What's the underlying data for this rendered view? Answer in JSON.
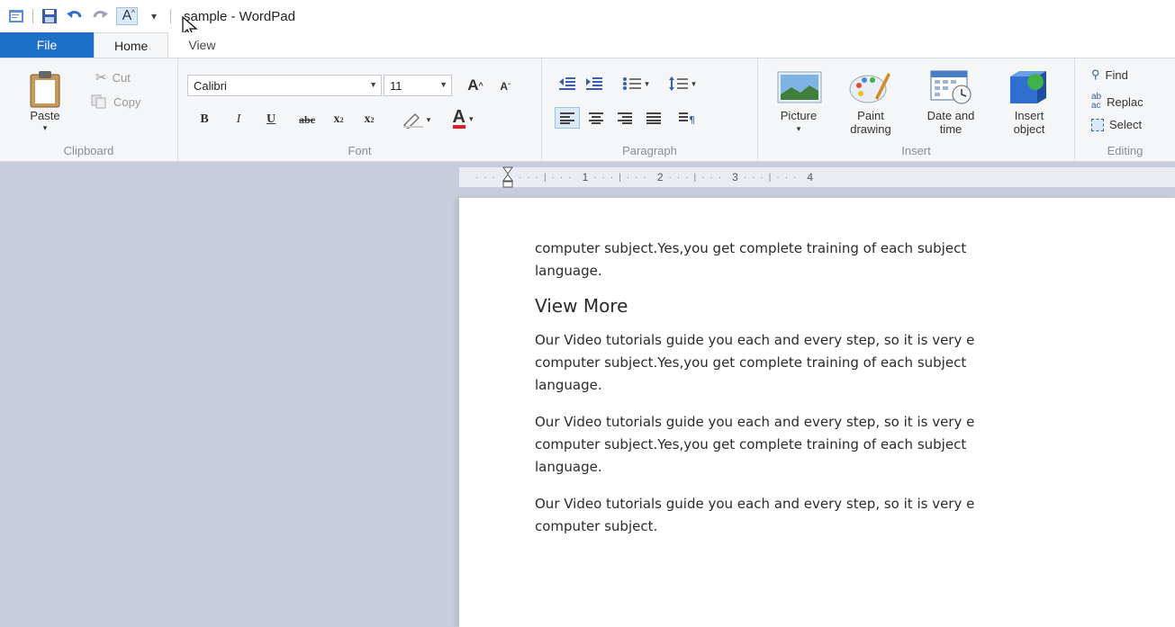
{
  "window": {
    "title": "sample - WordPad"
  },
  "tabs": [
    {
      "label": "File"
    },
    {
      "label": "Home"
    },
    {
      "label": "View"
    }
  ],
  "ribbon": {
    "clipboard": {
      "group_label": "Clipboard",
      "paste_label": "Paste",
      "cut_label": "Cut",
      "copy_label": "Copy"
    },
    "font": {
      "group_label": "Font",
      "font_family": "Calibri",
      "font_size": "11"
    },
    "paragraph": {
      "group_label": "Paragraph"
    },
    "insert": {
      "group_label": "Insert",
      "picture_label": "Picture",
      "paint_label": "Paint\ndrawing",
      "paint_label_line1": "Paint",
      "paint_label_line2": "drawing",
      "datetime_line1": "Date and",
      "datetime_line2": "time",
      "object_line1": "Insert",
      "object_line2": "object"
    },
    "editing": {
      "group_label": "Editing",
      "find_label": "Find",
      "replace_label": "Replac",
      "select_label": "Select"
    }
  },
  "ruler": {
    "marks": [
      "1",
      "2",
      "3",
      "4"
    ]
  },
  "document": {
    "line1": "computer subject.Yes,you get complete training of each subject",
    "line2": "language.",
    "heading": "View More",
    "para1_l1": "Our Video tutorials guide you each and every step, so it is very e",
    "para1_l2": "computer subject.Yes,you get complete training of each subject",
    "para1_l3": "language.",
    "para2_l1": "Our Video tutorials guide you each and every step, so it is very e",
    "para2_l2": "computer subject.Yes,you get complete training of each subject",
    "para2_l3": "language.",
    "para3_l1": "Our Video tutorials guide you each and every step, so it is very e",
    "para3_l2": "computer subject."
  },
  "colors": {
    "file_tab": "#1e6fc8",
    "font_color_underline": "#e02020",
    "workspace_bg": "#c7cddc"
  }
}
